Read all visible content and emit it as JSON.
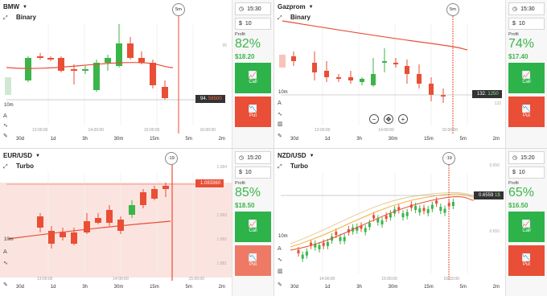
{
  "panels": [
    {
      "asset": "BMW",
      "mode": "Binary",
      "expiry_tag": "5m",
      "price_tag": "94.",
      "price_tag_hi": "56500",
      "time_ticks": [
        "13:00:00",
        "14:00:00",
        "15:00:00",
        "16:00:00"
      ],
      "y_ticks": [
        "95"
      ],
      "timeframes": [
        "30d",
        "1d",
        "3h",
        "30m",
        "15m",
        "5m",
        "2m"
      ],
      "interval": "10m",
      "time": "15:30",
      "amount": "10",
      "profit_label": "Profit",
      "profit_pct": "82%",
      "payout": "$18.20",
      "call": "Call",
      "put": "Put"
    },
    {
      "asset": "Gazprom",
      "mode": "Binary",
      "expiry_tag": "5m",
      "price_tag": "132.",
      "price_tag_hi": "1250",
      "time_ticks": [
        "13:00:00",
        "14:00:00",
        "15:00:00"
      ],
      "y_ticks": [
        "132"
      ],
      "timeframes": [
        "30d",
        "1d",
        "3h",
        "30m",
        "15m",
        "5m",
        "2m"
      ],
      "interval": "10m",
      "time": "15:30",
      "amount": "10",
      "profit_label": "Profit",
      "profit_pct": "74%",
      "payout": "$17.40",
      "call": "Call",
      "put": "Put"
    },
    {
      "asset": "EUR/USD",
      "mode": "Turbo",
      "expiry_tag": ":19",
      "price_tag": "1.08",
      "price_tag_hi": "3360",
      "time_ticks": [
        "13:00:00",
        "14:00:00",
        "15:00:00"
      ],
      "y_ticks": [
        "1.084",
        "1.083",
        "1.082",
        "1.081"
      ],
      "timeframes": [
        "30d",
        "1d",
        "3h",
        "30m",
        "15m",
        "5m",
        "2m"
      ],
      "interval": "10m",
      "time": "15:20",
      "amount": "10",
      "profit_label": "Profit",
      "profit_pct": "85%",
      "payout": "$18.50",
      "call": "Call",
      "put": "Put"
    },
    {
      "asset": "NZD/USD",
      "mode": "Turbo",
      "expiry_tag": ":19",
      "price_tag": "0.6559",
      "price_tag_hi": "1$",
      "time_ticks": [
        "14:00:00",
        "15:00:00",
        "15:15:00"
      ],
      "y_ticks": [
        "0.656",
        "0.655"
      ],
      "timeframes": [
        "30d",
        "1d",
        "3h",
        "30m",
        "15m",
        "5m",
        "2m"
      ],
      "interval": "10m",
      "time": "15:20",
      "amount": "10",
      "profit_label": "Profit",
      "profit_pct": "65%",
      "payout": "$16.50",
      "call": "Call",
      "put": "Put"
    }
  ],
  "colors": {
    "up": "#3bb54a",
    "down": "#e94e36",
    "accent_green": "#2eb24a",
    "accent_red": "#e94e36"
  },
  "icons": [
    "chevron-down-icon",
    "clock-icon",
    "dollar-icon",
    "pencil-icon",
    "crosshair-icon",
    "chart-type-icon",
    "text-icon",
    "wave-icon",
    "call-chart-icon",
    "put-chart-icon"
  ],
  "zoom_controls": [
    "−",
    "✥",
    "+"
  ]
}
